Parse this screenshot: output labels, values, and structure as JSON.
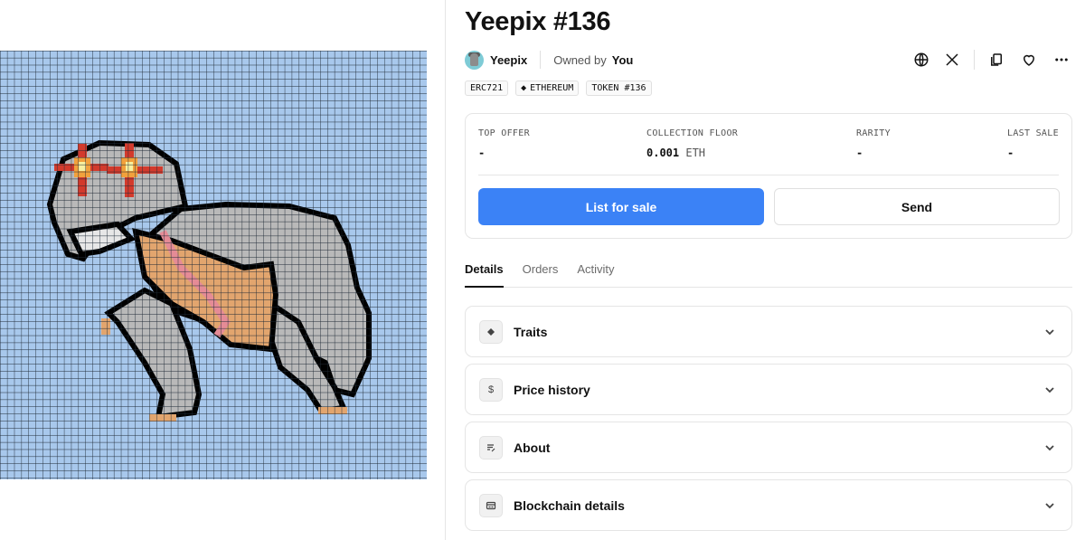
{
  "nft": {
    "title": "Yeepix #136",
    "collection_name": "Yeepix",
    "owned_by_label": "Owned by",
    "owner": "You"
  },
  "tags": [
    {
      "label": "ERC721"
    },
    {
      "label": "ETHEREUM",
      "icon": "ethereum-icon"
    },
    {
      "label": "TOKEN #136"
    }
  ],
  "stats": {
    "top_offer": {
      "label": "TOP OFFER",
      "value": "-"
    },
    "collection_floor": {
      "label": "COLLECTION FLOOR",
      "value": "0.001",
      "unit": "ETH"
    },
    "rarity": {
      "label": "RARITY",
      "value": "-"
    },
    "last_sale": {
      "label": "LAST SALE",
      "value": "-"
    }
  },
  "buttons": {
    "list_for_sale": "List for sale",
    "send": "Send"
  },
  "tabs": [
    {
      "label": "Details",
      "active": true
    },
    {
      "label": "Orders",
      "active": false
    },
    {
      "label": "Activity",
      "active": false
    }
  ],
  "sections": [
    {
      "label": "Traits",
      "icon": "diamond-icon"
    },
    {
      "label": "Price history",
      "icon": "dollar-icon"
    },
    {
      "label": "About",
      "icon": "text-edit-icon"
    },
    {
      "label": "Blockchain details",
      "icon": "card-icon"
    }
  ],
  "actions": {
    "icons": [
      "globe-icon",
      "x-logo-icon",
      "copy-icon",
      "heart-icon",
      "more-icon"
    ]
  },
  "colors": {
    "primary_button": "#3b82f6",
    "artwork_background": "#a8c8ec",
    "pixel_grid": "#1f2a36"
  }
}
